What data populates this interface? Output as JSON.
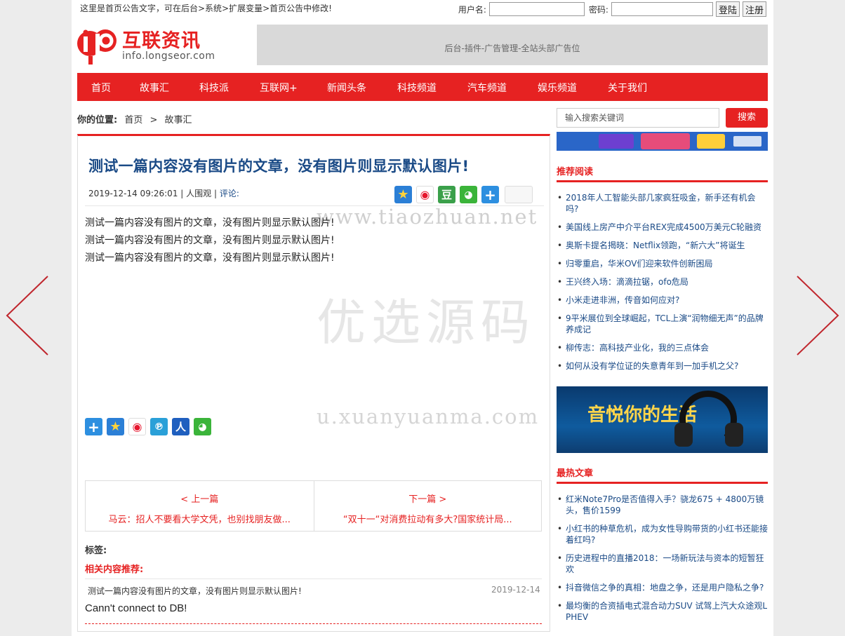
{
  "topbar": {
    "notice": "这里是首页公告文字，可在后台>系统>扩展变量>首页公告中修改!",
    "username_label": "用户名:",
    "password_label": "密码:",
    "login_button": "登陆",
    "register_button": "注册"
  },
  "logo": {
    "text": "互联资讯",
    "sub": "info.longseor.com"
  },
  "ad_top": "后台-插件-广告管理-全站头部广告位",
  "nav": [
    "首页",
    "故事汇",
    "科技派",
    "互联网+",
    "新闻头条",
    "科技频道",
    "汽车频道",
    "娱乐频道",
    "关于我们"
  ],
  "breadcrumb": {
    "label": "你的位置:",
    "home": "首页",
    "sep": ">",
    "current": "故事汇"
  },
  "article": {
    "title": "测试一篇内容没有图片的文章，没有图片则显示默认图片!",
    "datetime": "2019-12-14 09:26:01",
    "author": "人围观",
    "comment": "评论:",
    "paragraphs": [
      "测试一篇内容没有图片的文章，没有图片则显示默认图片!",
      "测试一篇内容没有图片的文章，没有图片则显示默认图片!",
      "测试一篇内容没有图片的文章，没有图片则显示默认图片!"
    ],
    "watermarks": [
      "www.tiaozhuan.net",
      "优选源码",
      "u.xuanyuanma.com"
    ]
  },
  "prev": {
    "label": "< 上一篇",
    "title": "马云：招人不要看大学文凭，也别找朋友做..."
  },
  "next": {
    "label": "下一篇 >",
    "title": "“双十一“对消费拉动有多大?国家统计局..."
  },
  "tags_label": "标签:",
  "related": {
    "heading": "相关内容推荐:",
    "item": "测试一篇内容没有图片的文章，没有图片则显示默认图片!",
    "date": "2019-12-14"
  },
  "db_error": "Cann't connect to DB!",
  "sidebar": {
    "search_placeholder": "输入搜索关键词",
    "search_button": "搜索",
    "recommend_heading": "推荐阅读",
    "recommend": [
      "2018年人工智能头部几家疯狂吸金，新手还有机会吗?",
      "美国线上房产中介平台REX完成4500万美元C轮融资",
      "奥斯卡提名揭晓：Netflix领跑，“新六大”将诞生",
      "归零重启，华米OV们迎来软件创新困局",
      "王兴终入场：滴滴拉锯，ofo危局",
      "小米走进非洲，传音如何应对?",
      "9平米展位到全球崛起，TCL上演“润物细无声”的品牌养成记",
      "柳传志：高科技产业化，我的三点体会",
      "如何从没有学位证的失意青年到一加手机之父?"
    ],
    "ad_music": "音悦你的生活",
    "hot_heading": "最热文章",
    "hot": [
      "红米Note7Pro是否值得入手？骁龙675 + 4800万镜头，售价1599",
      "小红书的种草危机，成为女性导购带货的小红书还能接着红吗?",
      "历史进程中的直播2018：一场新玩法与资本的短暂狂欢",
      "抖音微信之争的真相：地盘之争，还是用户隐私之争?",
      "最均衡的合资插电式混合动力SUV 试驾上汽大众途观L PHEV"
    ]
  },
  "colors": {
    "brand_red": "#e62222",
    "link_blue": "#1a4a86"
  },
  "icons": {
    "share_top": [
      "qzone-icon",
      "weibo-icon",
      "douban-icon",
      "wechat-icon",
      "more-plus-icon"
    ],
    "share_bottom": [
      "more-plus-icon",
      "qzone-icon",
      "weibo-icon",
      "tencent-weibo-icon",
      "renren-icon",
      "wechat-icon"
    ]
  }
}
